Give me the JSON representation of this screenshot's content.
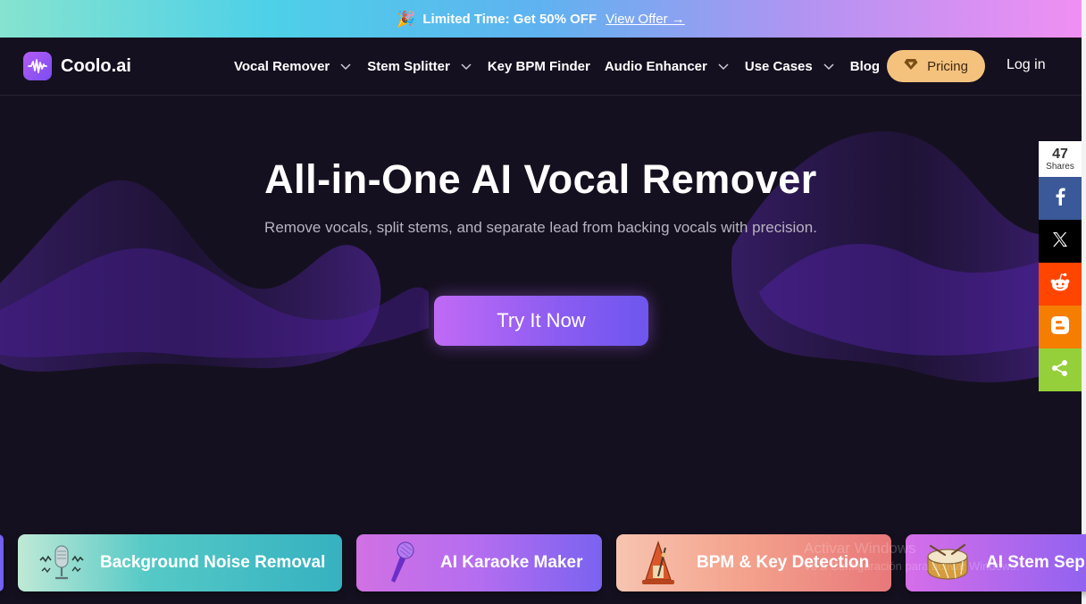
{
  "promo": {
    "icon": "party-popper-icon",
    "text": "Limited Time: Get 50% OFF",
    "link": "View Offer →"
  },
  "brand": {
    "name": "Coolo.ai",
    "icon": "waveform-icon"
  },
  "nav": {
    "items": [
      {
        "label": "Vocal Remover",
        "dropdown": true
      },
      {
        "label": "Stem Splitter",
        "dropdown": true
      },
      {
        "label": "Key BPM Finder",
        "dropdown": false
      },
      {
        "label": "Audio Enhancer",
        "dropdown": true
      },
      {
        "label": "Use Cases",
        "dropdown": true
      },
      {
        "label": "Blog",
        "dropdown": false
      }
    ],
    "pricing": "Pricing",
    "login": "Log in"
  },
  "hero": {
    "title": "All-in-One AI Vocal Remover",
    "subtitle": "Remove vocals, split stems, and separate lead from backing vocals with precision.",
    "cta": "Try It Now"
  },
  "share": {
    "count": "47",
    "count_label": "Shares",
    "buttons": [
      {
        "name": "facebook",
        "color": "#3b5998"
      },
      {
        "name": "x",
        "color": "#000000"
      },
      {
        "name": "reddit",
        "color": "#ff4500"
      },
      {
        "name": "blogger",
        "color": "#f57d00"
      },
      {
        "name": "sharethis",
        "color": "#95d03a"
      }
    ]
  },
  "cards": [
    {
      "label": "Background Noise Removal",
      "icon": "microphone-noise-icon"
    },
    {
      "label": "AI Karaoke Maker",
      "icon": "karaoke-microphone-icon"
    },
    {
      "label": "BPM & Key Detection",
      "icon": "metronome-icon"
    },
    {
      "label": "AI Stem Sep",
      "icon": "drum-icon"
    }
  ],
  "watermark": {
    "line1": "Activar Windows",
    "line2": "Ve a Configuración para activar Windows."
  }
}
